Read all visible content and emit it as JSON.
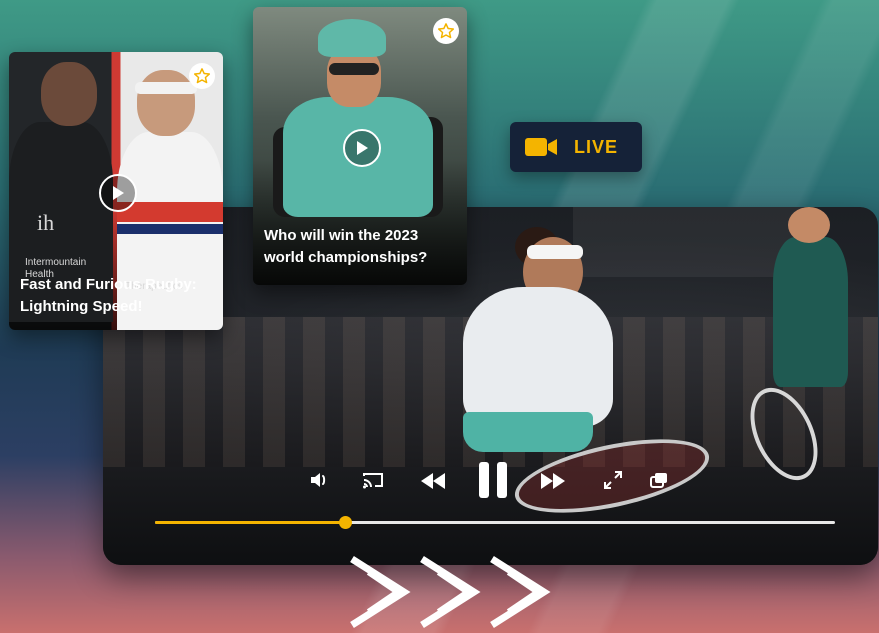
{
  "player": {
    "progress_percent": 28,
    "controls": [
      "volume",
      "cast",
      "rewind",
      "pause",
      "fast-forward",
      "fullscreen",
      "picture-in-picture"
    ]
  },
  "cards": [
    {
      "title": "Fast and Furious Rugby: Lightning Speed!",
      "sponsor_lines": [
        "Intermountain",
        "Health",
        "Therapeutics"
      ],
      "logo": "ih",
      "favorite_icon": "star-icon",
      "play_icon": "play-icon"
    },
    {
      "title": "Who will win the 2023 world championships?",
      "favorite_icon": "star-icon",
      "play_icon": "play-icon"
    }
  ],
  "live_badge": {
    "label": "LIVE",
    "icon": "video-camera-icon"
  },
  "colors": {
    "accent": "#f4b400",
    "badge_bg": "#152238",
    "progress_track": "#e8e8e8"
  }
}
